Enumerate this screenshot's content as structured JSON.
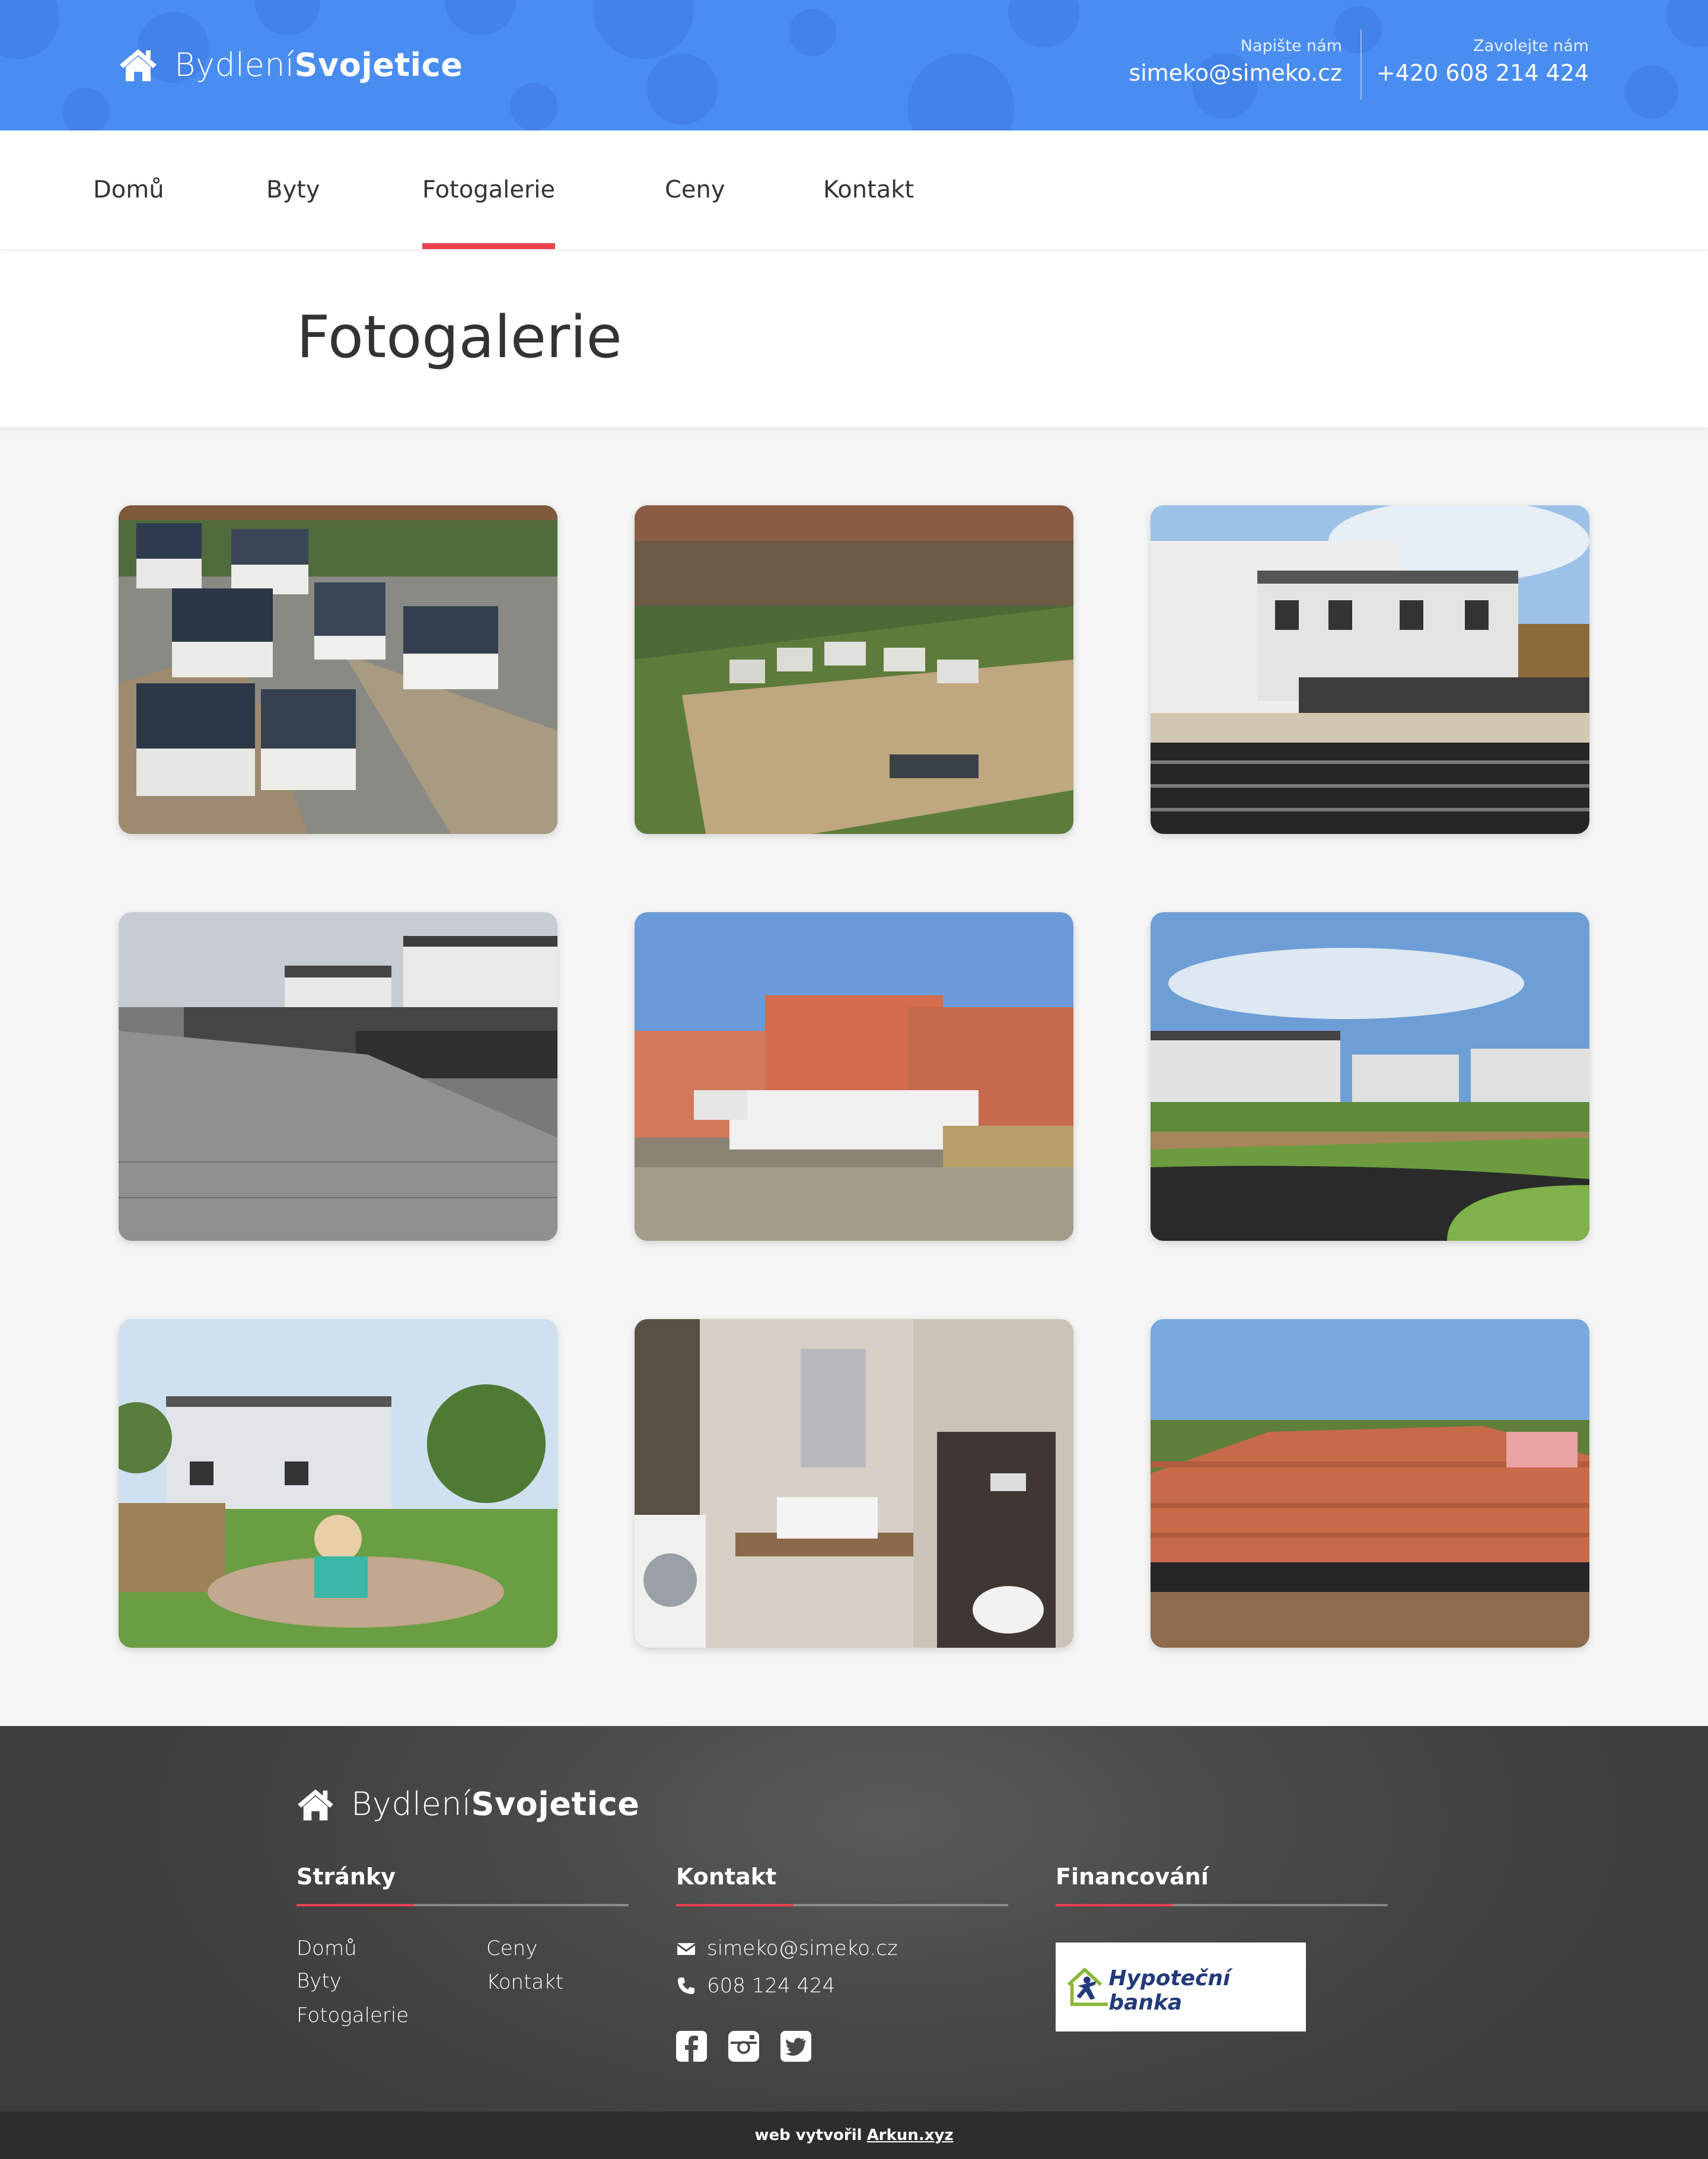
{
  "brand": {
    "name_light": "Bydlení",
    "name_bold": "Svojetice"
  },
  "header": {
    "email_label": "Napište nám",
    "email": "simeko@simeko.cz",
    "phone_label": "Zavolejte nám",
    "phone": "+420 608 214 424",
    "color": "#4a8df0"
  },
  "nav": {
    "items": [
      {
        "label": "Domů"
      },
      {
        "label": "Byty"
      },
      {
        "label": "Fotogalerie",
        "active": true
      },
      {
        "label": "Ceny"
      },
      {
        "label": "Kontakt"
      }
    ],
    "active_color": "#e84250"
  },
  "page": {
    "title": "Fotogalerie"
  },
  "gallery": {
    "photos": [
      {
        "subject": "aerial view of semi-detached houses under construction"
      },
      {
        "subject": "aerial view of village and new houses"
      },
      {
        "subject": "white houses with dark fence"
      },
      {
        "subject": "paved road with fence and houses"
      },
      {
        "subject": "brick houses with scaffolding"
      },
      {
        "subject": "visualisation of houses and new road"
      },
      {
        "subject": "garden with child and house"
      },
      {
        "subject": "bathroom interior with washing machine"
      },
      {
        "subject": "brick walls on foundation"
      }
    ]
  },
  "footer": {
    "brand": {
      "name_light": "Bydlení",
      "name_bold": "Svojetice"
    },
    "pages": {
      "title": "Stránky",
      "links": [
        "Domů",
        "Byty",
        "Fotogalerie",
        "Ceny",
        "Kontakt"
      ]
    },
    "contact": {
      "title": "Kontakt",
      "email": "simeko@simeko.cz",
      "phone": "608 124 424",
      "social": [
        "facebook-icon",
        "instagram-icon",
        "twitter-icon"
      ]
    },
    "financing": {
      "title": "Financování",
      "partner": "Hypoteční banka"
    }
  },
  "credits": {
    "text": "web vytvořil",
    "link": "Arkun.xyz"
  }
}
